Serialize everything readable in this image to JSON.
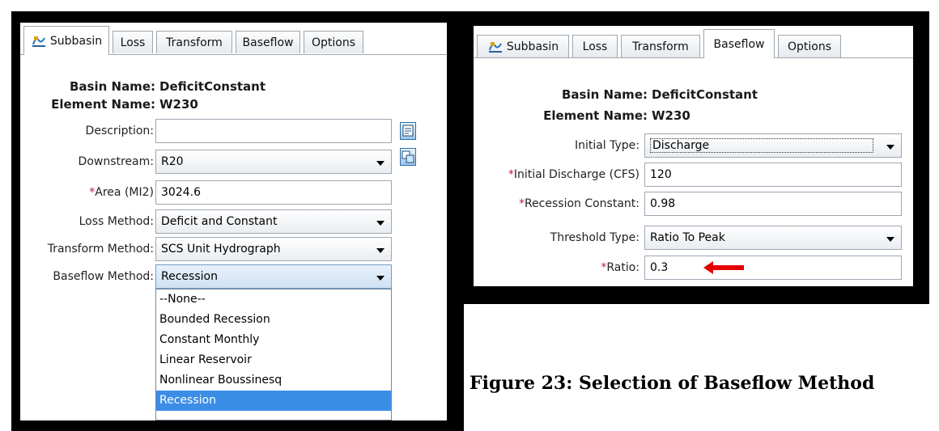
{
  "left_panel": {
    "tabs": [
      {
        "label": "Subbasin",
        "active": true
      },
      {
        "label": "Loss",
        "active": false
      },
      {
        "label": "Transform",
        "active": false
      },
      {
        "label": "Baseflow",
        "active": false
      },
      {
        "label": "Options",
        "active": false
      }
    ],
    "basin_label": "Basin Name:",
    "basin_value": "DeficitConstant",
    "element_label": "Element Name:",
    "element_value": "W230",
    "description_label": "Description:",
    "description_value": "",
    "downstream_label": "Downstream:",
    "downstream_value": "R20",
    "area_label": "Area (MI2)",
    "area_value": "3024.6",
    "loss_method_label": "Loss Method:",
    "loss_method_value": "Deficit and Constant",
    "transform_method_label": "Transform Method:",
    "transform_method_value": "SCS Unit Hydrograph",
    "baseflow_method_label": "Baseflow Method:",
    "baseflow_method_value": "Recession",
    "baseflow_options": [
      "--None--",
      "Bounded Recession",
      "Constant Monthly",
      "Linear Reservoir",
      "Nonlinear Boussinesq",
      "Recession"
    ]
  },
  "right_panel": {
    "tabs": [
      {
        "label": "Subbasin",
        "active": false
      },
      {
        "label": "Loss",
        "active": false
      },
      {
        "label": "Transform",
        "active": false
      },
      {
        "label": "Baseflow",
        "active": true
      },
      {
        "label": "Options",
        "active": false
      }
    ],
    "basin_label": "Basin Name:",
    "basin_value": "DeficitConstant",
    "element_label": "Element Name:",
    "element_value": "W230",
    "initial_type_label": "Initial Type:",
    "initial_type_value": "Discharge",
    "initial_discharge_label": "Initial Discharge (CFS)",
    "initial_discharge_value": "120",
    "recession_constant_label": "Recession Constant:",
    "recession_constant_value": "0.98",
    "threshold_type_label": "Threshold Type:",
    "threshold_type_value": "Ratio To Peak",
    "ratio_label": "Ratio:",
    "ratio_value": "0.3"
  },
  "caption": "Figure 23: Selection of Baseflow Method",
  "colors": {
    "required_asterisk": "#d0103a",
    "annotation_arrow": "#e60000",
    "selection": "#3b8de6"
  },
  "icons": [
    "subbasin-icon",
    "description-editor-icon",
    "downstream-selector-icon",
    "red-arrow-icon"
  ]
}
